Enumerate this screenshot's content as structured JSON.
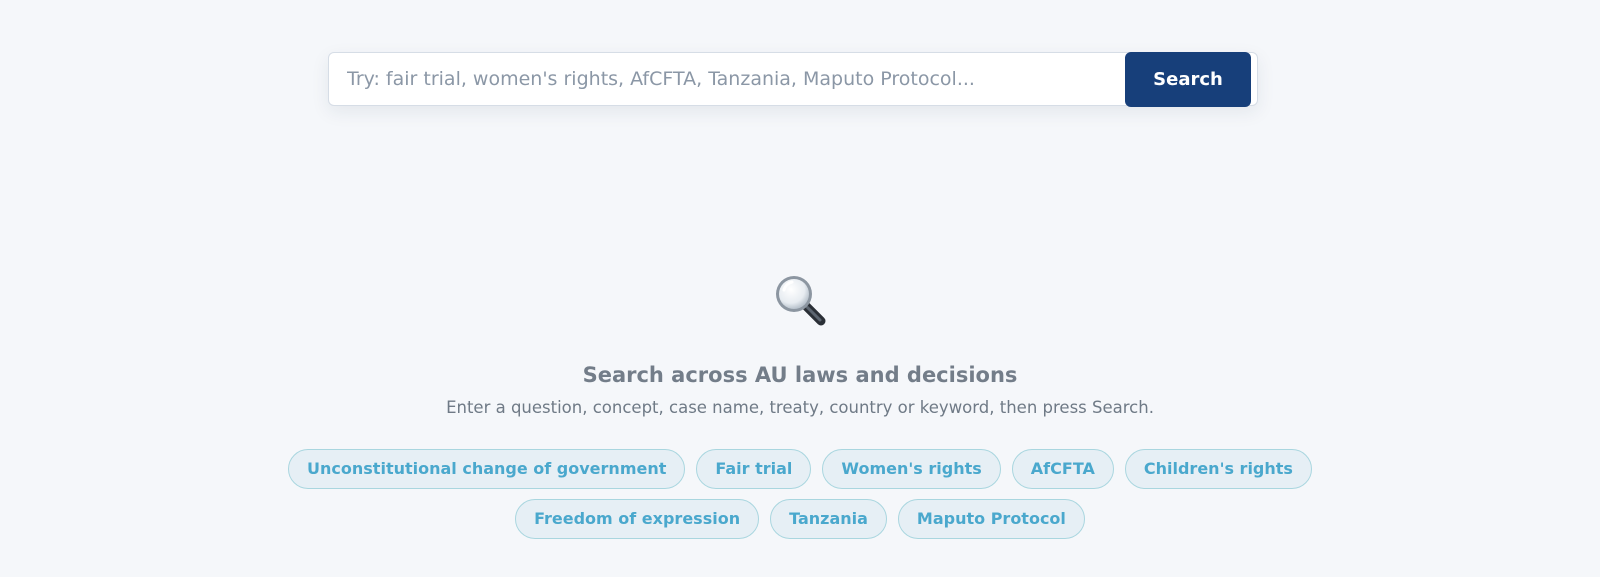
{
  "search": {
    "placeholder": "Try: fair trial, women's rights, AfCFTA, Tanzania, Maputo Protocol...",
    "value": "",
    "button_label": "Search"
  },
  "empty_state": {
    "icon": "magnifying-glass-icon",
    "title": "Search across AU laws and decisions",
    "subtitle": "Enter a question, concept, case name, treaty, country or keyword, then press Search."
  },
  "suggestions": [
    "Unconstitutional change of government",
    "Fair trial",
    "Women's rights",
    "AfCFTA",
    "Children's rights",
    "Freedom of expression",
    "Tanzania",
    "Maputo Protocol"
  ],
  "colors": {
    "background": "#f5f7fa",
    "primary_button": "#173f7a",
    "chip_text": "#4aa8cd",
    "chip_background": "#e6eff5",
    "chip_border": "#a9d6df"
  }
}
